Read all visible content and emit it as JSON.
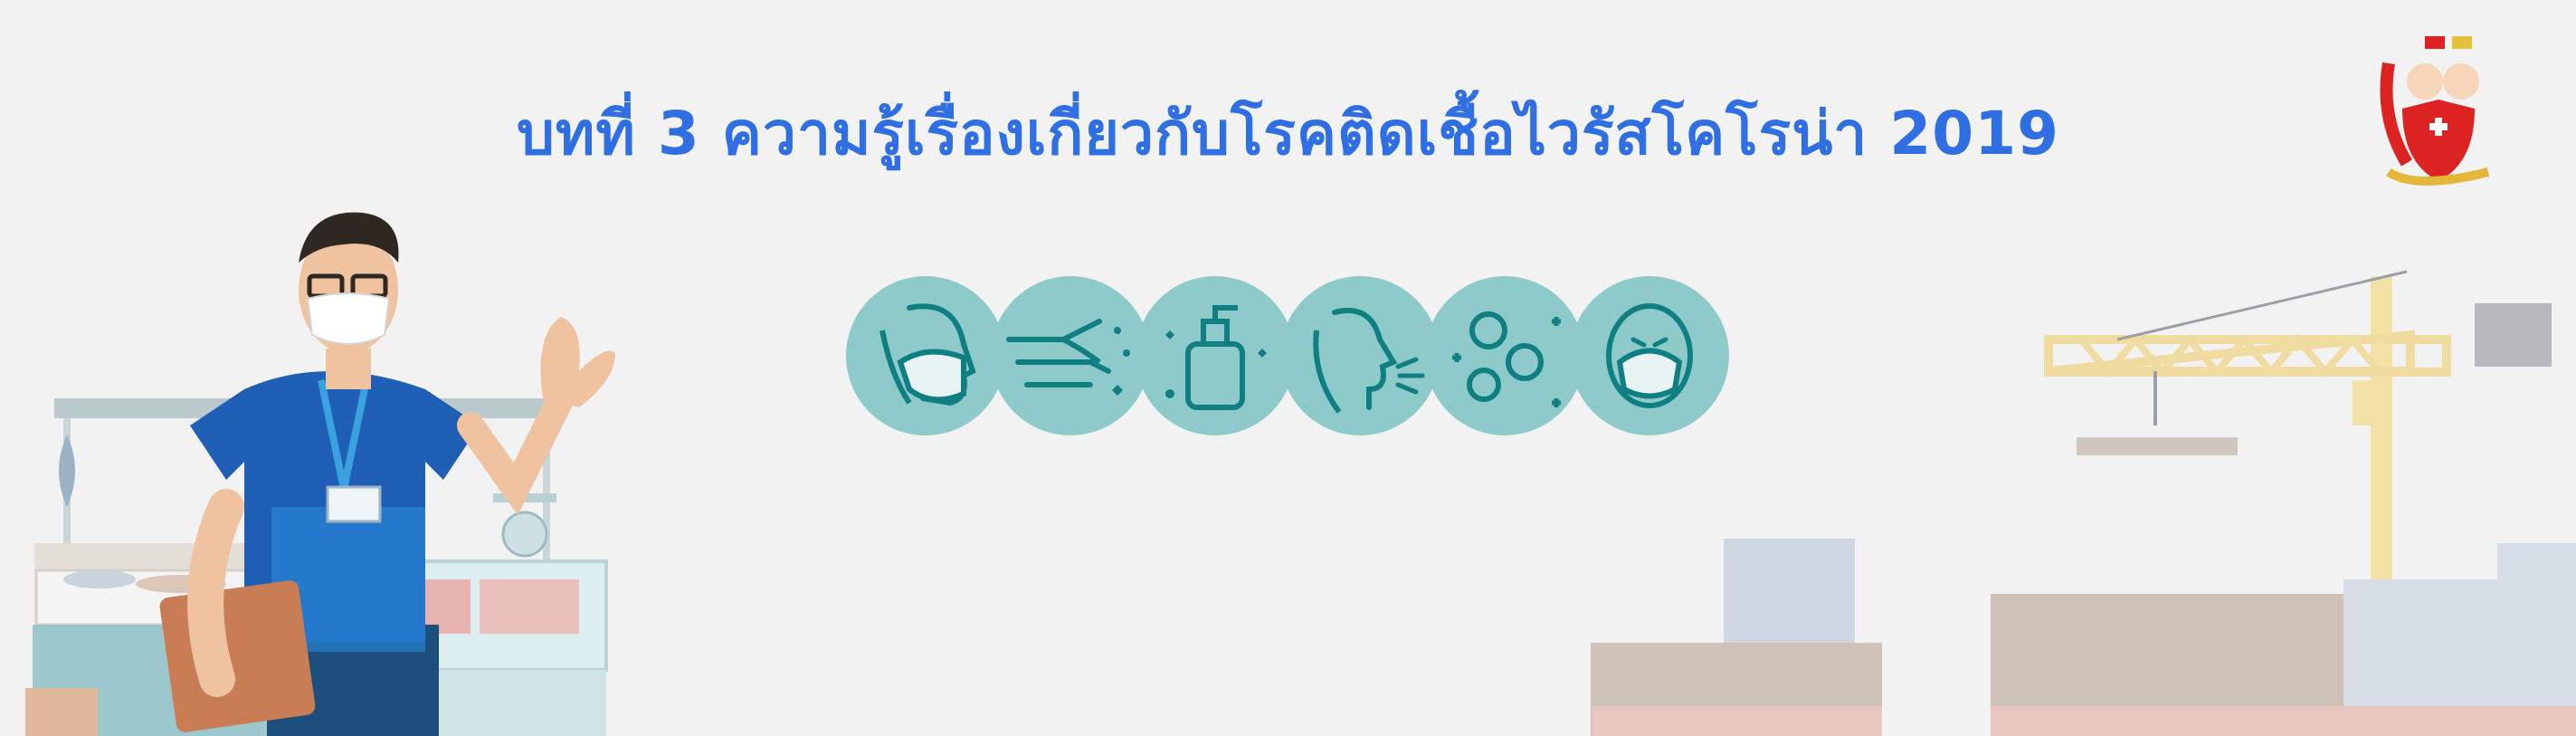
{
  "banner": {
    "title": "บทที่ 3 ความรู้เรื่องเกี่ยวกับโรคติดเชื้อไวรัสโคโรน่า 2019"
  },
  "colors": {
    "background": "#f2f2f2",
    "title": "#2f6ee3",
    "icon_circle": "#8ecaca",
    "icon_stroke": "#0f7f82",
    "shirt": "#1f5fb6",
    "lanyard": "#3aa3df"
  },
  "icons": [
    {
      "name": "face-mask-icon"
    },
    {
      "name": "hand-washing-icon"
    },
    {
      "name": "sanitizer-bottle-icon"
    },
    {
      "name": "sneeze-icon"
    },
    {
      "name": "virus-icon"
    },
    {
      "name": "n95-mask-icon"
    }
  ]
}
